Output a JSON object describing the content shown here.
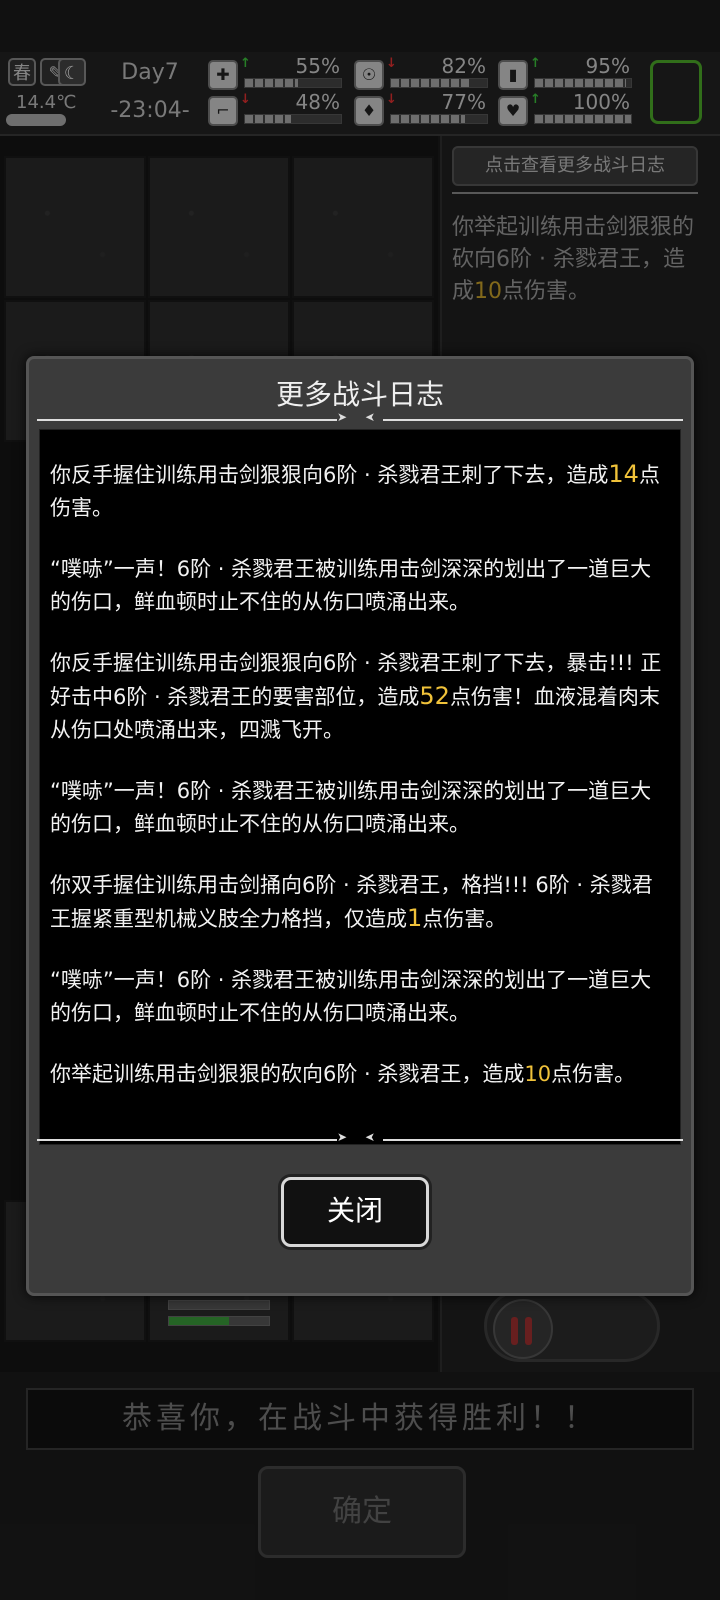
{
  "status": {
    "season": "春",
    "temperature": "14.4℃",
    "day": "Day7",
    "time": "-23:04-",
    "stats": [
      {
        "icon": "medkit-icon",
        "trend": "up",
        "value": "55%",
        "level": 0.55
      },
      {
        "icon": "stomach-icon",
        "trend": "down",
        "value": "82%",
        "level": 0.82
      },
      {
        "icon": "battery-icon",
        "trend": "up",
        "value": "95%",
        "level": 0.95
      },
      {
        "icon": "boot-icon",
        "trend": "down",
        "value": "48%",
        "level": 0.48
      },
      {
        "icon": "water-drop-icon",
        "trend": "down",
        "value": "77%",
        "level": 0.77
      },
      {
        "icon": "heart-icon",
        "trend": "up",
        "value": "100%",
        "level": 1.0
      }
    ]
  },
  "panel": {
    "log_button": "点击查看更多战斗日志",
    "text_a": "你举起训练用击剑狠狠的砍向6阶 · 杀戮君王，造成",
    "text_num": "10",
    "text_b": "点伤害。"
  },
  "victory_text": "恭喜你，在战斗中获得胜利！！",
  "confirm_label": "确定",
  "modal": {
    "title": "更多战斗日志",
    "close_label": "关闭",
    "entries": [
      {
        "a": "你反手握住训练用击剑狠狠向6阶 · 杀戮君王刺了下去，造成",
        "num": "14",
        "b": "点伤害。"
      },
      {
        "a": "“噗哧”一声！6阶 · 杀戮君王被训练用击剑深深的划出了一道巨大的伤口，鲜血顿时止不住的从伤口喷涌出来。",
        "num": "",
        "b": ""
      },
      {
        "a": "你反手握住训练用击剑狠狠向6阶 · 杀戮君王刺了下去，暴击!!! 正好击中6阶 · 杀戮君王的要害部位，造成",
        "num": "52",
        "b": "点伤害！血液混着肉末从伤口处喷涌出来，四溅飞开。"
      },
      {
        "a": "“噗哧”一声！6阶 · 杀戮君王被训练用击剑深深的划出了一道巨大的伤口，鲜血顿时止不住的从伤口喷涌出来。",
        "num": "",
        "b": ""
      },
      {
        "a": "你双手握住训练用击剑捅向6阶 · 杀戮君王，格挡!!! 6阶 · 杀戮君王握紧重型机械义肢全力格挡，仅造成",
        "num": "1",
        "b": "点伤害。"
      },
      {
        "a": "“噗哧”一声！6阶 · 杀戮君王被训练用击剑深深的划出了一道巨大的伤口，鲜血顿时止不住的从伤口喷涌出来。",
        "num": "",
        "b": ""
      },
      {
        "a": "你举起训练用击剑狠狠的砍向6阶 · 杀戮君王，造成",
        "num": "10",
        "b": "点伤害。"
      }
    ]
  }
}
